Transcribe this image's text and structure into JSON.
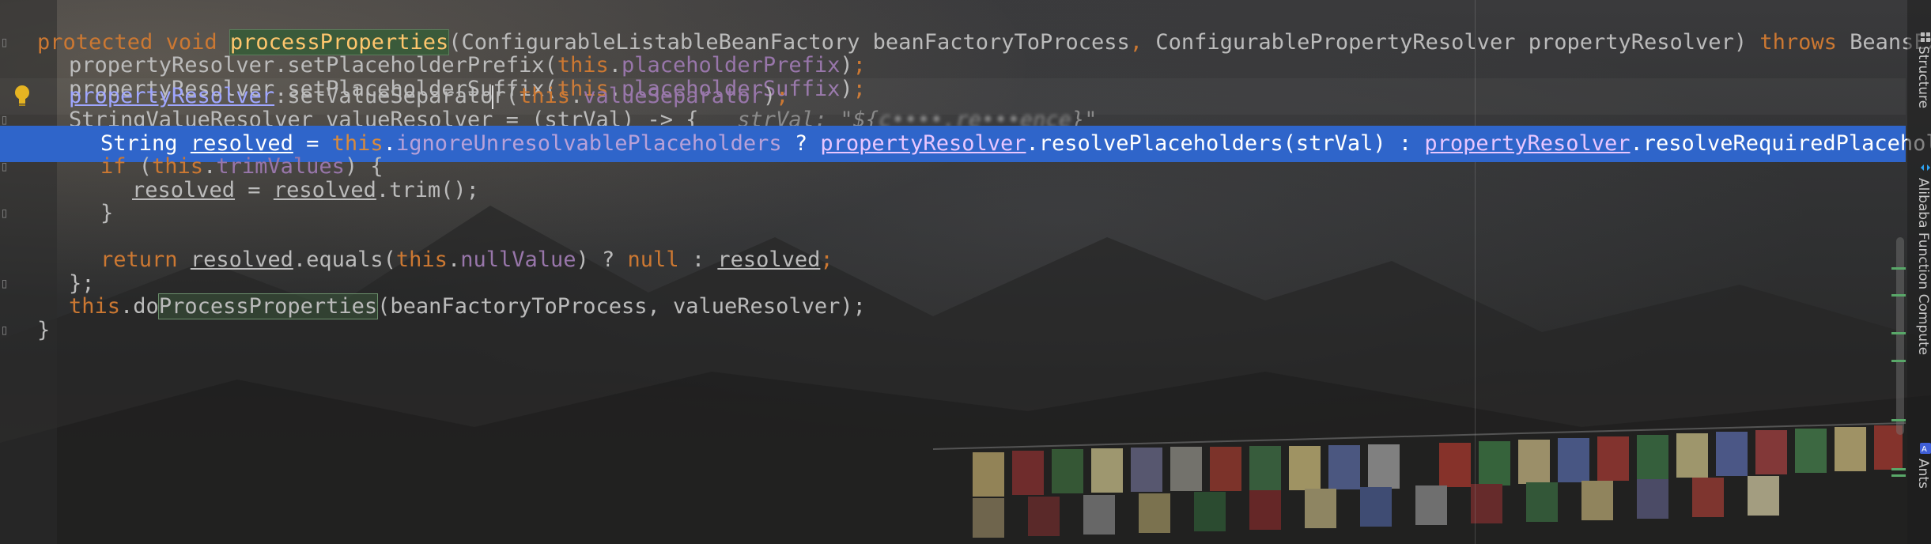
{
  "editor": {
    "lines": [
      {
        "text": "protected void processProperties(ConfigurableListableBeanFactory beanFactoryToProcess, ConfigurablePropertyResolver propertyResolver) throws BeansExcep"
      },
      {
        "text": "    propertyResolver.setPlaceholderPrefix(this.placeholderPrefix);"
      },
      {
        "text": "    propertyResolver.setPlaceholderSuffix(this.placeholderSuffix);"
      },
      {
        "text": "    propertyResolver.setValueSeparator(this.valueSeparator);"
      },
      {
        "text": "    StringValueResolver valueResolver = (strVal) -> {   strVal: \"${"
      },
      {
        "text": "        String resolved = this.ignoreUnresolvablePlaceholders ? propertyResolver.resolvePlaceholders(strVal) : propertyResolver.resolveRequiredPlacehol"
      },
      {
        "text": "        if (this.trimValues) {"
      },
      {
        "text": "            resolved = resolved.trim();"
      },
      {
        "text": "        }"
      },
      {
        "text": ""
      },
      {
        "text": "        return resolved.equals(this.nullValue) ? null : resolved;"
      },
      {
        "text": "    };"
      },
      {
        "text": "    this.doProcessProperties(beanFactoryToProcess, valueResolver);"
      },
      {
        "text": "}"
      }
    ],
    "inline_hint": {
      "label": "strVal:",
      "value_prefix": "\"${",
      "value_blurred": "c••••.re•••ence",
      "value_suffix": "}\""
    },
    "tokens": {
      "protected": "protected",
      "void": "void",
      "method_name": "processProperties",
      "param_type_1": "ConfigurableListableBeanFactory",
      "param_1": "beanFactoryToProcess",
      "param_type_2": "ConfigurablePropertyResolver",
      "param_2": "propertyResolver",
      "throws": "throws",
      "exception": "BeansExcep",
      "resolver": "propertyResolver",
      "set_prefix": ".setPlaceholderPrefix(",
      "set_suffix": ".setPlaceholderSuffix(",
      "set_sep_a": ".setValueSeparato",
      "set_sep_b": "r(",
      "this": "this",
      "placeholderPrefix": "placeholderPrefix",
      "placeholderSuffix": "placeholderSuffix",
      "valueSeparator": "valueSeparator",
      "svr_decl": "StringValueResolver valueResolver = (strVal) -> {",
      "string_type": "String",
      "resolved": "resolved",
      "ignore": "ignoreUnresolvablePlaceholders",
      "resolve_placeholders": ".resolvePlaceholders(strVal) : ",
      "resolve_required": ".resolveRequiredPlacehol",
      "if": "if",
      "trimValues": "trimValues",
      "trim_call": ".trim();",
      "return": "return",
      "equals": ".equals(",
      "nullValue": "nullValue",
      "null": "null",
      "close_lambda": "};",
      "do_prefix": "do",
      "do_method": "ProcessProperties",
      "do_args": "(beanFactoryToProcess, valueResolver);",
      "close_brace": "}"
    }
  },
  "right_panel": {
    "labels": [
      "Structure",
      "Alibaba Function Compute",
      "Ants"
    ]
  },
  "colors": {
    "keyword": "#cc7832",
    "method_decl": "#ffc66d",
    "field": "#9876aa",
    "default_text": "#bbbbbb",
    "selection": "#2f65ca",
    "hint": "#8a8a8a",
    "link": "#9fa6ff"
  }
}
